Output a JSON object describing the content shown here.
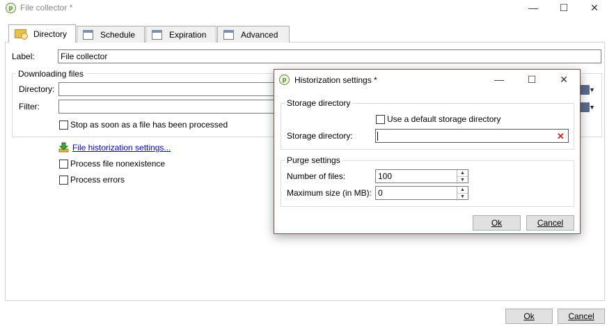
{
  "window": {
    "title": "File collector *",
    "minimize": "—",
    "maximize": "☐",
    "close": "✕"
  },
  "tabs": [
    {
      "label": "Directory"
    },
    {
      "label": "Schedule"
    },
    {
      "label": "Expiration"
    },
    {
      "label": "Advanced"
    }
  ],
  "form": {
    "label_caption": "Label:",
    "label_value": "File collector",
    "downloading_title": "Downloading files",
    "directory_caption": "Directory:",
    "directory_value": "",
    "filter_caption": "Filter:",
    "filter_value": "",
    "stop_label": "Stop as soon as a file has been processed",
    "historization_link": "File historization settings...",
    "nonexistence_label": "Process file nonexistence",
    "errors_label": "Process errors"
  },
  "footer": {
    "ok": "Ok",
    "cancel": "Cancel"
  },
  "dialog": {
    "title": "Historization settings *",
    "minimize": "—",
    "maximize": "☐",
    "close": "✕",
    "storage_group": "Storage directory",
    "use_default_label": "Use a default storage directory",
    "storage_dir_caption": "Storage directory:",
    "storage_dir_value": "",
    "clear_icon": "✕",
    "purge_group": "Purge settings",
    "files_caption": "Number of files:",
    "files_value": "100",
    "maxsize_caption": "Maximum size (in MB):",
    "maxsize_value": "0",
    "spin_up": "▲",
    "spin_down": "▼",
    "ok": "Ok",
    "cancel": "Cancel"
  },
  "colors": {
    "link": "#0000cc",
    "dialog_border": "#8b4a4a",
    "clear_icon": "#d62020"
  }
}
